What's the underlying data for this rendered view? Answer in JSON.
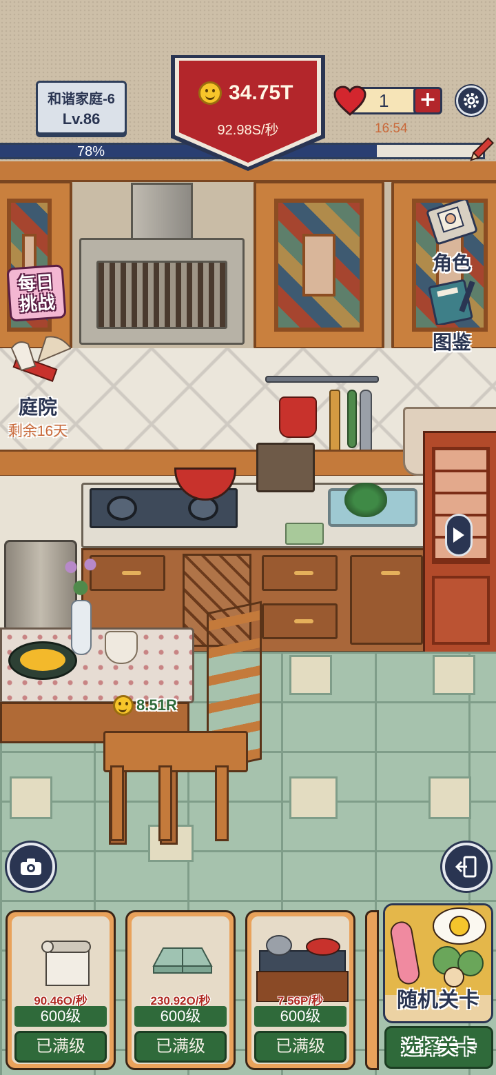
{
  "hud": {
    "home_name": "和谐家庭-6",
    "level": "Lv.86",
    "progress_pct": 78,
    "progress_label": "78%",
    "coins": "34.75T",
    "coin_rate": "92.98S/秒",
    "lives": "1",
    "life_timer": "16:54",
    "colors": {
      "banner_red": "#b3262b",
      "navy": "#2a3552",
      "green": "#2f6a3a"
    }
  },
  "side_menu": {
    "daily_challenge_line1": "每日",
    "daily_challenge_line2": "挑战",
    "courtyard_label": "庭院",
    "courtyard_remaining": "剩余16天",
    "character_label": "角色",
    "collection_label": "图鉴"
  },
  "scene": {
    "table_income": "8.51R"
  },
  "cards": [
    {
      "rate": "90.46O/秒",
      "level": "600级",
      "button": "已满级",
      "item": "rolled-blind"
    },
    {
      "rate": "230.92O/秒",
      "level": "600级",
      "button": "已满级",
      "item": "floor-mat"
    },
    {
      "rate": "7.56P/秒",
      "level": "600级",
      "button": "已满级",
      "item": "stove-set"
    }
  ],
  "actions": {
    "random_level": "随机关卡",
    "select_level": "选择关卡"
  },
  "icons": {
    "settings": "gear-icon",
    "camera": "camera-icon",
    "exit": "exit-door-icon",
    "heart": "heart-icon",
    "plus": "plus-icon",
    "coin": "smiley-coin-icon"
  }
}
